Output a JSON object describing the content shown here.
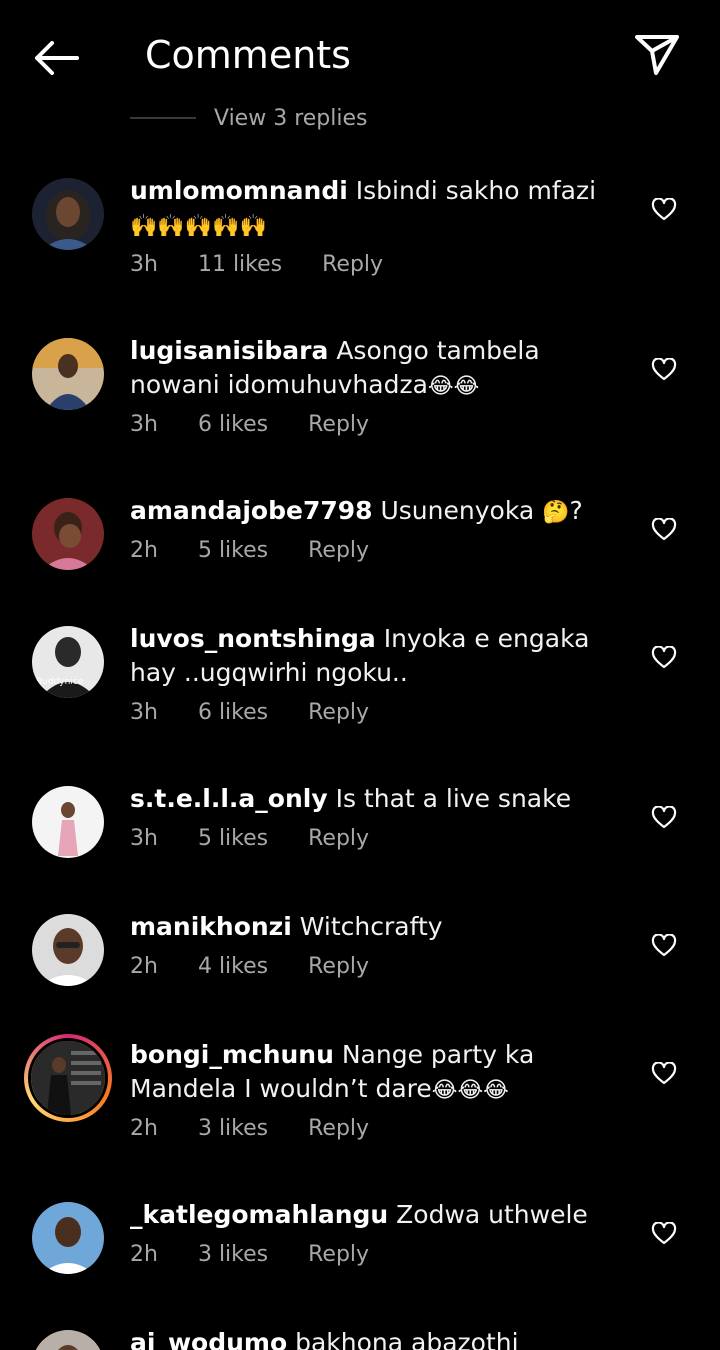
{
  "header": {
    "title": "Comments"
  },
  "view_replies": "View 3 replies",
  "comments": [
    {
      "username": "umlomomnandi",
      "text": "Isbindi sakho mfazi",
      "emojis": "🙌🙌🙌🙌🙌",
      "time": "3h",
      "likes": "11 likes",
      "reply": "Reply"
    },
    {
      "username": "lugisanisibara",
      "text": "Asongo tambela nowani idomuhuvhadza",
      "emojis": "😂😂",
      "time": "3h",
      "likes": "6 likes",
      "reply": "Reply"
    },
    {
      "username": "amandajobe7798",
      "text": "Usunenyoka",
      "emojis": "🤔",
      "suffix": "?",
      "time": "2h",
      "likes": "5 likes",
      "reply": "Reply"
    },
    {
      "username": "luvos_nontshinga",
      "text": "Inyoka e engaka hay ..ugqwirhi ngoku..",
      "avatar_text": "Buddynice",
      "time": "3h",
      "likes": "6 likes",
      "reply": "Reply"
    },
    {
      "username": "s.t.e.l.l.a_only",
      "text": "Is that a live snake",
      "time": "3h",
      "likes": "5 likes",
      "reply": "Reply"
    },
    {
      "username": "manikhonzi",
      "text": "Witchcrafty",
      "time": "2h",
      "likes": "4 likes",
      "reply": "Reply"
    },
    {
      "username": "bongi_mchunu",
      "text": "Nange party ka Mandela I wouldn’t dare",
      "emojis": "😂😂😂",
      "time": "2h",
      "likes": "3 likes",
      "reply": "Reply"
    },
    {
      "username": "_katlegomahlangu",
      "text": "Zodwa uthwele",
      "time": "2h",
      "likes": "3 likes",
      "reply": "Reply"
    },
    {
      "username": "aj_wodumo",
      "text": "bakhona abazothi"
    }
  ]
}
